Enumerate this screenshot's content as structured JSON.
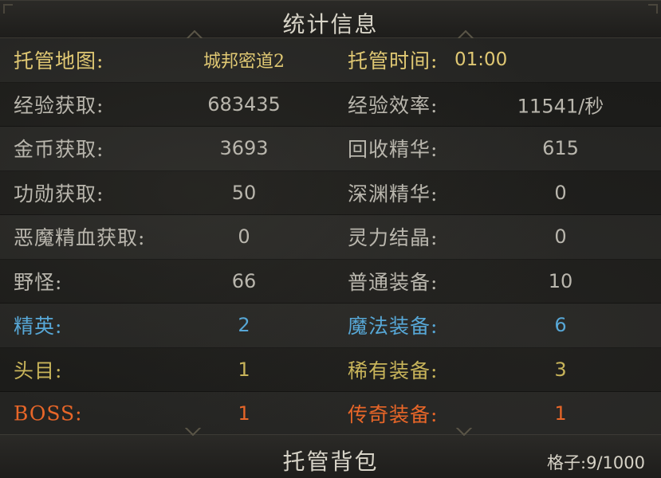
{
  "stats_panel": {
    "title": "统计信息",
    "map_label": "托管地图:",
    "map_value": "城邦密道2",
    "time_label": "托管时间:",
    "time_value": "01:00",
    "rows": [
      {
        "label_l": "经验获取:",
        "value_l": "683435",
        "label_r": "经验效率:",
        "value_r": "11541/秒",
        "tone": "white"
      },
      {
        "label_l": "金币获取:",
        "value_l": "3693",
        "label_r": "回收精华:",
        "value_r": "615",
        "tone": "white"
      },
      {
        "label_l": "功勋获取:",
        "value_l": "50",
        "label_r": "深渊精华:",
        "value_r": "0",
        "tone": "white"
      },
      {
        "label_l": "恶魔精血获取:",
        "value_l": "0",
        "label_r": "灵力结晶:",
        "value_r": "0",
        "tone": "white"
      },
      {
        "label_l": "野怪:",
        "value_l": "66",
        "label_r": "普通装备:",
        "value_r": "10",
        "tone": "white"
      },
      {
        "label_l": "精英:",
        "value_l": "2",
        "label_r": "魔法装备:",
        "value_r": "6",
        "tone": "blue"
      },
      {
        "label_l": "头目:",
        "value_l": "1",
        "label_r": "稀有装备:",
        "value_r": "3",
        "tone": "yellow"
      },
      {
        "label_l": "BOSS:",
        "value_l": "1",
        "label_r": "传奇装备:",
        "value_r": "1",
        "tone": "orange"
      }
    ]
  },
  "bag_panel": {
    "title": "托管背包",
    "capacity_label": "格子:",
    "capacity_value": "9/1000"
  },
  "colors": {
    "gold": "#e0c873",
    "white": "#b9b6ad",
    "blue": "#57a7d6",
    "yellow": "#c8b45a",
    "orange": "#e86628"
  }
}
